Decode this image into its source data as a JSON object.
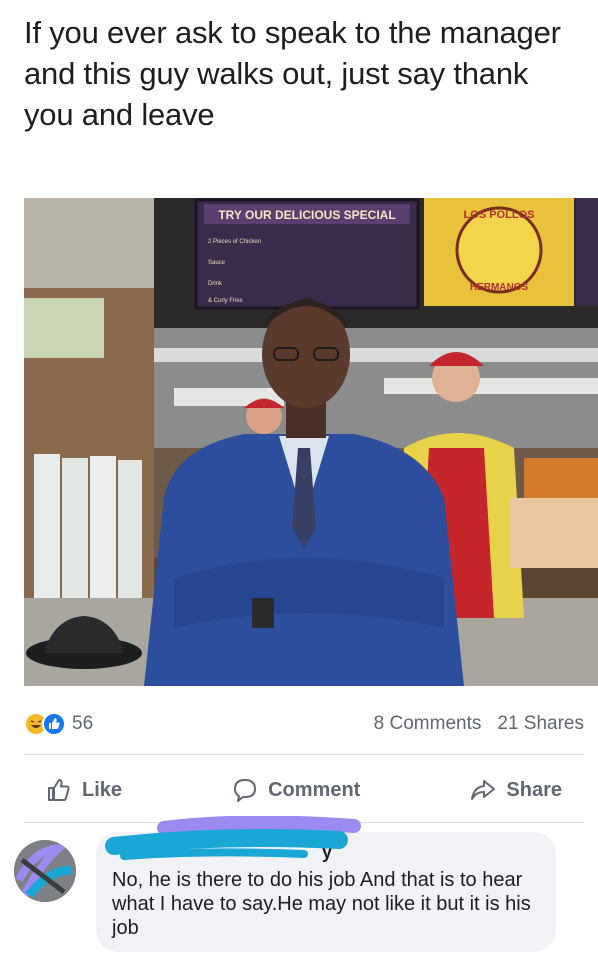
{
  "post": {
    "text": "If you ever ask to speak to the manager and this guy walks out, just say thank you and leave"
  },
  "photo": {
    "menu_title": "TRY OUR DELICIOUS SPECIAL",
    "menu_items": [
      "2 Pieces of Chicken",
      "Sauce",
      "Drink",
      "& Curly Fries"
    ],
    "logo_top": "LOS POLLOS",
    "logo_bottom": "HERMANOS"
  },
  "stats": {
    "reaction_count": "56",
    "comments": "8 Comments",
    "shares": "21 Shares"
  },
  "actions": {
    "like": "Like",
    "comment": "Comment",
    "share": "Share"
  },
  "comment": {
    "author_visible": "y",
    "text": "No, he is there to do his job And that is to hear what I have to say.He may not like it but it is his job"
  },
  "colors": {
    "like_blue": "#1877f2",
    "haha_yellow": "#f7b928",
    "scribble_blue": "#1aa7d6",
    "scribble_purple": "#9b8bf0"
  }
}
